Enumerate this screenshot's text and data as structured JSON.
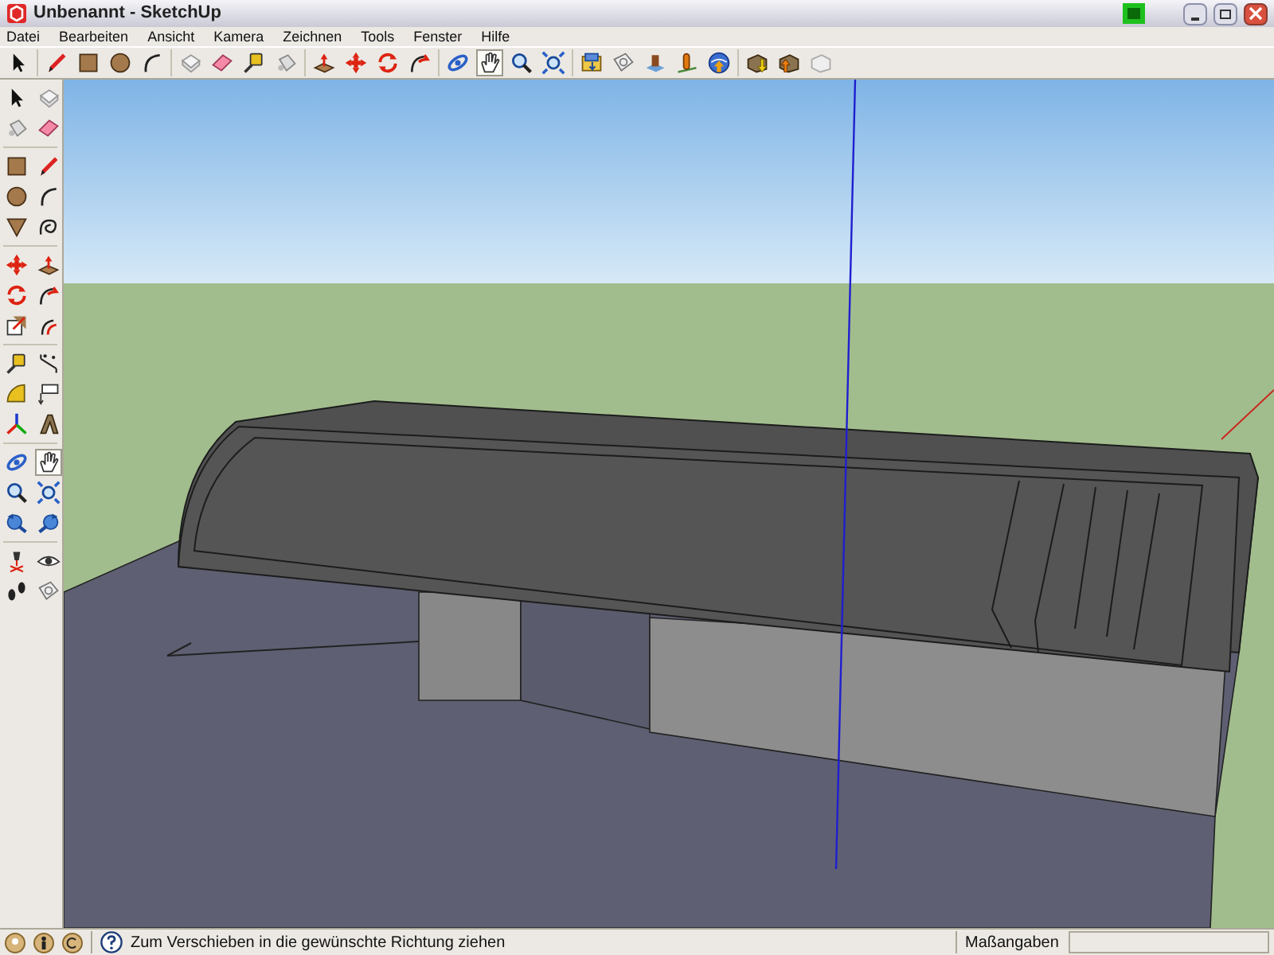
{
  "window": {
    "title": "Unbenannt - SketchUp"
  },
  "menu": [
    "Datei",
    "Bearbeiten",
    "Ansicht",
    "Kamera",
    "Zeichnen",
    "Tools",
    "Fenster",
    "Hilfe"
  ],
  "top_toolbar": [
    [
      {
        "kind": "select",
        "selected": false
      }
    ],
    [
      {
        "kind": "pencil",
        "selected": false
      },
      {
        "kind": "rect",
        "selected": false
      },
      {
        "kind": "circle",
        "selected": false
      },
      {
        "kind": "arc",
        "selected": false
      }
    ],
    [
      {
        "kind": "component",
        "selected": false
      },
      {
        "kind": "eraser",
        "selected": false
      },
      {
        "kind": "tape",
        "selected": false
      },
      {
        "kind": "bucket",
        "selected": false
      }
    ],
    [
      {
        "kind": "pushpull",
        "selected": false
      },
      {
        "kind": "move",
        "selected": false
      },
      {
        "kind": "rotate",
        "selected": false
      },
      {
        "kind": "followme",
        "selected": false
      }
    ],
    [
      {
        "kind": "orbit",
        "selected": false
      },
      {
        "kind": "pan",
        "selected": true
      },
      {
        "kind": "zoom",
        "selected": false
      },
      {
        "kind": "zoomext",
        "selected": false
      }
    ],
    [
      {
        "kind": "scene",
        "selected": false
      },
      {
        "kind": "section",
        "selected": false
      },
      {
        "kind": "warehouse",
        "selected": false
      },
      {
        "kind": "location",
        "selected": false
      },
      {
        "kind": "globe",
        "selected": false
      }
    ],
    [
      {
        "kind": "boxdown",
        "selected": false
      },
      {
        "kind": "boxup",
        "selected": false
      },
      {
        "kind": "boxgrey",
        "selected": false
      }
    ]
  ],
  "left_toolbar": [
    [
      {
        "kind": "select",
        "selected": false
      },
      {
        "kind": "component",
        "selected": false
      },
      {
        "kind": "bucket",
        "selected": false
      },
      {
        "kind": "eraser",
        "selected": false
      }
    ],
    [
      {
        "kind": "rect",
        "selected": false
      },
      {
        "kind": "pencil",
        "selected": false
      },
      {
        "kind": "circle",
        "selected": false
      },
      {
        "kind": "arc",
        "selected": false
      },
      {
        "kind": "polygon",
        "selected": false
      },
      {
        "kind": "freehand",
        "selected": false
      }
    ],
    [
      {
        "kind": "move",
        "selected": false
      },
      {
        "kind": "pushpull",
        "selected": false
      },
      {
        "kind": "rotate",
        "selected": false
      },
      {
        "kind": "followme",
        "selected": false
      },
      {
        "kind": "scale",
        "selected": false
      },
      {
        "kind": "offset",
        "selected": false
      }
    ],
    [
      {
        "kind": "tape",
        "selected": false
      },
      {
        "kind": "dimension",
        "selected": false
      },
      {
        "kind": "protractor",
        "selected": false
      },
      {
        "kind": "text",
        "selected": false
      },
      {
        "kind": "axes",
        "selected": false
      },
      {
        "kind": "text3d",
        "selected": false
      }
    ],
    [
      {
        "kind": "orbit",
        "selected": false
      },
      {
        "kind": "pan",
        "selected": true
      },
      {
        "kind": "zoom",
        "selected": false
      },
      {
        "kind": "zoomext",
        "selected": false
      },
      {
        "kind": "prev",
        "selected": false
      },
      {
        "kind": "next",
        "selected": false
      }
    ],
    [
      {
        "kind": "camera",
        "selected": false
      },
      {
        "kind": "eye",
        "selected": false
      },
      {
        "kind": "walk",
        "selected": false
      },
      {
        "kind": "section",
        "selected": false
      }
    ]
  ],
  "status_bar": {
    "message": "Zum Verschieben in die gewünschte Richtung ziehen",
    "measurements_label": "Maßangaben"
  }
}
